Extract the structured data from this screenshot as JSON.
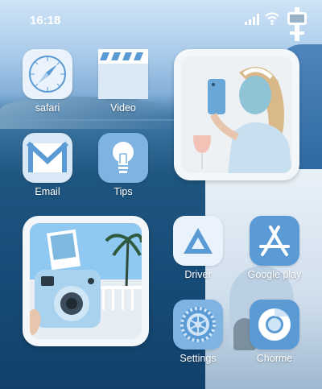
{
  "status_bar": {
    "time": "16:18",
    "signal_icon": "cellular-signal-icon",
    "wifi_icon": "wifi-icon",
    "battery_icon": "battery-icon"
  },
  "apps": {
    "safari": {
      "label": "safari",
      "icon": "compass-icon"
    },
    "video": {
      "label": "Video",
      "icon": "clapperboard-icon"
    },
    "email": {
      "label": "Email",
      "icon": "envelope-icon"
    },
    "tips": {
      "label": "Tips",
      "icon": "lightbulb-icon"
    },
    "driver": {
      "label": "Driver",
      "icon": "drive-triangle-icon"
    },
    "google_play": {
      "label": "Google play",
      "icon": "app-store-icon"
    },
    "settings": {
      "label": "Settings",
      "icon": "gear-icon"
    },
    "chrome": {
      "label": "Chorme",
      "icon": "chrome-icon"
    }
  },
  "widgets": {
    "photo_top": {
      "subject": "selfie-photo"
    },
    "photo_bottom": {
      "subject": "instant-camera-photo"
    }
  },
  "colors": {
    "icon_bg": "#eaf3fb",
    "icon_accent": "#5b9bd5",
    "icon_accent_dark": "#3f7fc0"
  }
}
